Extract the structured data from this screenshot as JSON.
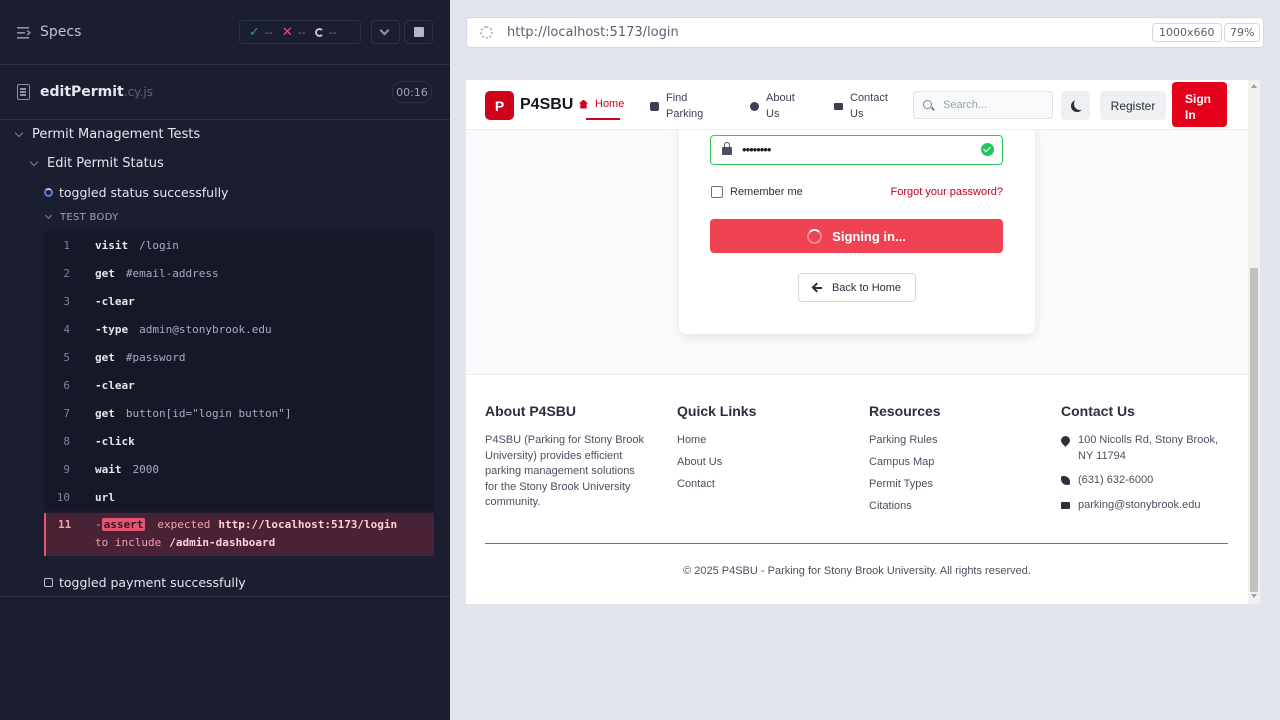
{
  "runner": {
    "specs_title": "Specs",
    "stats": {
      "passed": "--",
      "failed": "--",
      "pending": "--"
    },
    "spec": {
      "name": "editPermit",
      "ext": ".cy.js",
      "duration": "00:16"
    },
    "suite": "Permit Management Tests",
    "sub_suite": "Edit Permit Status",
    "tests": [
      {
        "title": "toggled status successfully",
        "state": "running"
      },
      {
        "title": "toggled payment successfully",
        "state": "pending"
      }
    ],
    "test_body_label": "TEST BODY",
    "commands": [
      {
        "num": "1",
        "name": "visit",
        "arg": "/login"
      },
      {
        "num": "2",
        "name": "get",
        "arg": "#email-address"
      },
      {
        "num": "3",
        "name": "-clear",
        "arg": ""
      },
      {
        "num": "4",
        "name": "-type",
        "arg": "admin@stonybrook.edu"
      },
      {
        "num": "5",
        "name": "get",
        "arg": "#password"
      },
      {
        "num": "6",
        "name": "-clear",
        "arg": ""
      },
      {
        "num": "7",
        "name": "get",
        "arg": "button[id=\"login button\"]"
      },
      {
        "num": "8",
        "name": "-click",
        "arg": ""
      },
      {
        "num": "9",
        "name": "wait",
        "arg": "2000"
      },
      {
        "num": "10",
        "name": "url",
        "arg": ""
      }
    ],
    "error_command": {
      "num": "11",
      "dash": "-",
      "name": "assert",
      "keyword": "expected",
      "value": "http://localhost:5173/login",
      "keyword2": "to include",
      "value2": "/admin-dashboard"
    }
  },
  "browser": {
    "url": "http://localhost:5173/login",
    "dimensions": "1000x660",
    "zoom": "79%"
  },
  "app": {
    "logo_letter": "P",
    "brand": "P4SBU",
    "nav": {
      "home": "Home",
      "find_parking_1": "Find",
      "find_parking_2": "Parking",
      "about_1": "About",
      "about_2": "Us",
      "contact_1": "Contact",
      "contact_2": "Us"
    },
    "search_placeholder": "Search...",
    "register": "Register",
    "sign_in_1": "Sign",
    "sign_in_2": "In",
    "login": {
      "password_value": "••••••••",
      "remember_me": "Remember me",
      "forgot": "Forgot your password?",
      "signing_in": "Signing in...",
      "back_home": "Back to Home"
    },
    "footer": {
      "about_title": "About P4SBU",
      "about_text": "P4SBU (Parking for Stony Brook University) provides efficient parking management solutions for the Stony Brook University community.",
      "quick_links_title": "Quick Links",
      "quick_links": [
        "Home",
        "About Us",
        "Contact"
      ],
      "resources_title": "Resources",
      "resources": [
        "Parking Rules",
        "Campus Map",
        "Permit Types",
        "Citations"
      ],
      "contact_title": "Contact Us",
      "address": "100 Nicolls Rd, Stony Brook, NY 11794",
      "phone": "(631) 632-6000",
      "email": "parking@stonybrook.edu",
      "copyright": "© 2025 P4SBU - Parking for Stony Brook University. All rights reserved."
    }
  },
  "colors": {
    "brand_red": "#d0021b",
    "pass_green": "#1fa971",
    "fail_red": "#e45770",
    "runner_bg": "#1b1e2e"
  }
}
